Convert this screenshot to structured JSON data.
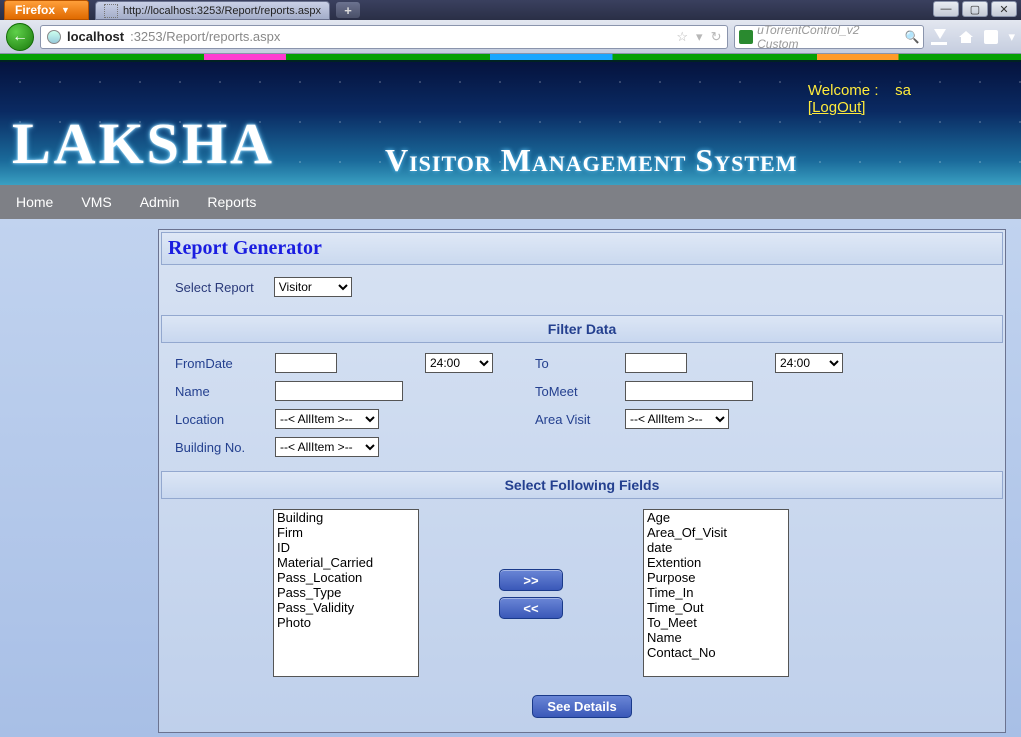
{
  "browser": {
    "menu_label": "Firefox",
    "tab_title": "http://localhost:3253/Report/reports.aspx",
    "url_host": "localhost",
    "url_port_path": ":3253/Report/reports.aspx",
    "search_placeholder": "uTorrentControl_v2 Custom"
  },
  "banner": {
    "logo": "LAKSHA",
    "subtitle": "Visitor Management System",
    "welcome_label": "Welcome :",
    "user": "sa",
    "logout_label": "[LogOut]"
  },
  "nav": {
    "items": [
      "Home",
      "VMS",
      "Admin",
      "Reports"
    ]
  },
  "panel": {
    "title": "Report Generator",
    "select_report_label": "Select Report",
    "report_options": [
      "Visitor"
    ],
    "filter_header": "Filter Data",
    "fields_header": "Select Following Fields",
    "labels": {
      "from_date": "FromDate",
      "to": "To",
      "name": "Name",
      "tomeet": "ToMeet",
      "location": "Location",
      "area_visit": "Area Visit",
      "building_no": "Building No."
    },
    "time_options": [
      "24:00"
    ],
    "allitem_option": "--< AllItem >--",
    "available_fields": [
      "Building",
      "Firm",
      "ID",
      "Material_Carried",
      "Pass_Location",
      "Pass_Type",
      "Pass_Validity",
      "Photo"
    ],
    "selected_fields": [
      "Age",
      "Area_Of_Visit",
      "date",
      "Extention",
      "Purpose",
      "Time_In",
      "Time_Out",
      "To_Meet",
      "Name",
      "Contact_No"
    ],
    "btn_add": ">>",
    "btn_remove": "<<",
    "btn_details": "See Details"
  }
}
